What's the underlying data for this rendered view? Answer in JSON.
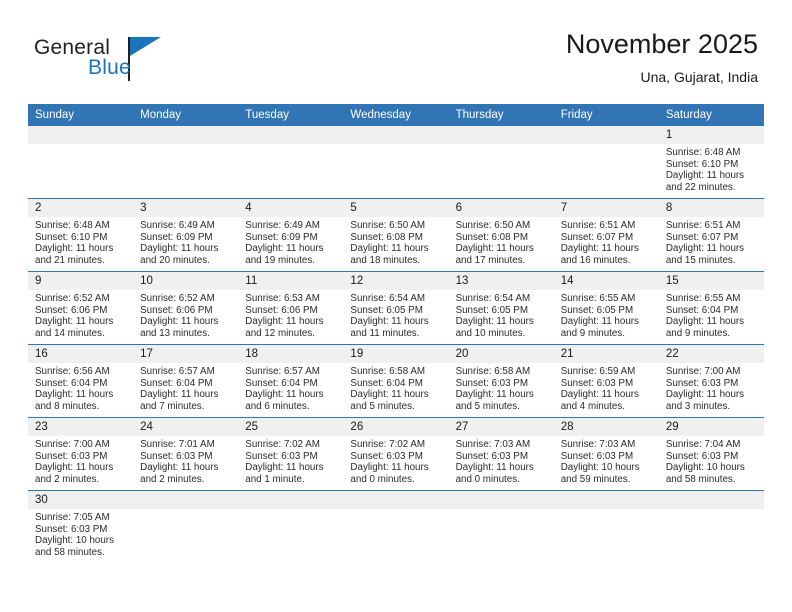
{
  "brand": {
    "name_top": "General",
    "name_bottom": "Blue",
    "accent_color": "#1b75bb",
    "text_color": "#231f20"
  },
  "header": {
    "title": "November 2025",
    "location": "Una, Gujarat, India"
  },
  "theme": {
    "header_blue": "#3175b4",
    "daynum_band": "#f0f0f0",
    "row_rule": "#3175b4"
  },
  "weekday_headers": [
    "Sunday",
    "Monday",
    "Tuesday",
    "Wednesday",
    "Thursday",
    "Friday",
    "Saturday"
  ],
  "weeks": [
    [
      {
        "day": "",
        "empty": true,
        "sunrise": "",
        "sunset": "",
        "daylight1": "",
        "daylight2": ""
      },
      {
        "day": "",
        "empty": true,
        "sunrise": "",
        "sunset": "",
        "daylight1": "",
        "daylight2": ""
      },
      {
        "day": "",
        "empty": true,
        "sunrise": "",
        "sunset": "",
        "daylight1": "",
        "daylight2": ""
      },
      {
        "day": "",
        "empty": true,
        "sunrise": "",
        "sunset": "",
        "daylight1": "",
        "daylight2": ""
      },
      {
        "day": "",
        "empty": true,
        "sunrise": "",
        "sunset": "",
        "daylight1": "",
        "daylight2": ""
      },
      {
        "day": "",
        "empty": true,
        "sunrise": "",
        "sunset": "",
        "daylight1": "",
        "daylight2": ""
      },
      {
        "day": "1",
        "empty": false,
        "sunrise": "Sunrise: 6:48 AM",
        "sunset": "Sunset: 6:10 PM",
        "daylight1": "Daylight: 11 hours",
        "daylight2": "and 22 minutes."
      }
    ],
    [
      {
        "day": "2",
        "empty": false,
        "sunrise": "Sunrise: 6:48 AM",
        "sunset": "Sunset: 6:10 PM",
        "daylight1": "Daylight: 11 hours",
        "daylight2": "and 21 minutes."
      },
      {
        "day": "3",
        "empty": false,
        "sunrise": "Sunrise: 6:49 AM",
        "sunset": "Sunset: 6:09 PM",
        "daylight1": "Daylight: 11 hours",
        "daylight2": "and 20 minutes."
      },
      {
        "day": "4",
        "empty": false,
        "sunrise": "Sunrise: 6:49 AM",
        "sunset": "Sunset: 6:09 PM",
        "daylight1": "Daylight: 11 hours",
        "daylight2": "and 19 minutes."
      },
      {
        "day": "5",
        "empty": false,
        "sunrise": "Sunrise: 6:50 AM",
        "sunset": "Sunset: 6:08 PM",
        "daylight1": "Daylight: 11 hours",
        "daylight2": "and 18 minutes."
      },
      {
        "day": "6",
        "empty": false,
        "sunrise": "Sunrise: 6:50 AM",
        "sunset": "Sunset: 6:08 PM",
        "daylight1": "Daylight: 11 hours",
        "daylight2": "and 17 minutes."
      },
      {
        "day": "7",
        "empty": false,
        "sunrise": "Sunrise: 6:51 AM",
        "sunset": "Sunset: 6:07 PM",
        "daylight1": "Daylight: 11 hours",
        "daylight2": "and 16 minutes."
      },
      {
        "day": "8",
        "empty": false,
        "sunrise": "Sunrise: 6:51 AM",
        "sunset": "Sunset: 6:07 PM",
        "daylight1": "Daylight: 11 hours",
        "daylight2": "and 15 minutes."
      }
    ],
    [
      {
        "day": "9",
        "empty": false,
        "sunrise": "Sunrise: 6:52 AM",
        "sunset": "Sunset: 6:06 PM",
        "daylight1": "Daylight: 11 hours",
        "daylight2": "and 14 minutes."
      },
      {
        "day": "10",
        "empty": false,
        "sunrise": "Sunrise: 6:52 AM",
        "sunset": "Sunset: 6:06 PM",
        "daylight1": "Daylight: 11 hours",
        "daylight2": "and 13 minutes."
      },
      {
        "day": "11",
        "empty": false,
        "sunrise": "Sunrise: 6:53 AM",
        "sunset": "Sunset: 6:06 PM",
        "daylight1": "Daylight: 11 hours",
        "daylight2": "and 12 minutes."
      },
      {
        "day": "12",
        "empty": false,
        "sunrise": "Sunrise: 6:54 AM",
        "sunset": "Sunset: 6:05 PM",
        "daylight1": "Daylight: 11 hours",
        "daylight2": "and 11 minutes."
      },
      {
        "day": "13",
        "empty": false,
        "sunrise": "Sunrise: 6:54 AM",
        "sunset": "Sunset: 6:05 PM",
        "daylight1": "Daylight: 11 hours",
        "daylight2": "and 10 minutes."
      },
      {
        "day": "14",
        "empty": false,
        "sunrise": "Sunrise: 6:55 AM",
        "sunset": "Sunset: 6:05 PM",
        "daylight1": "Daylight: 11 hours",
        "daylight2": "and 9 minutes."
      },
      {
        "day": "15",
        "empty": false,
        "sunrise": "Sunrise: 6:55 AM",
        "sunset": "Sunset: 6:04 PM",
        "daylight1": "Daylight: 11 hours",
        "daylight2": "and 9 minutes."
      }
    ],
    [
      {
        "day": "16",
        "empty": false,
        "sunrise": "Sunrise: 6:56 AM",
        "sunset": "Sunset: 6:04 PM",
        "daylight1": "Daylight: 11 hours",
        "daylight2": "and 8 minutes."
      },
      {
        "day": "17",
        "empty": false,
        "sunrise": "Sunrise: 6:57 AM",
        "sunset": "Sunset: 6:04 PM",
        "daylight1": "Daylight: 11 hours",
        "daylight2": "and 7 minutes."
      },
      {
        "day": "18",
        "empty": false,
        "sunrise": "Sunrise: 6:57 AM",
        "sunset": "Sunset: 6:04 PM",
        "daylight1": "Daylight: 11 hours",
        "daylight2": "and 6 minutes."
      },
      {
        "day": "19",
        "empty": false,
        "sunrise": "Sunrise: 6:58 AM",
        "sunset": "Sunset: 6:04 PM",
        "daylight1": "Daylight: 11 hours",
        "daylight2": "and 5 minutes."
      },
      {
        "day": "20",
        "empty": false,
        "sunrise": "Sunrise: 6:58 AM",
        "sunset": "Sunset: 6:03 PM",
        "daylight1": "Daylight: 11 hours",
        "daylight2": "and 5 minutes."
      },
      {
        "day": "21",
        "empty": false,
        "sunrise": "Sunrise: 6:59 AM",
        "sunset": "Sunset: 6:03 PM",
        "daylight1": "Daylight: 11 hours",
        "daylight2": "and 4 minutes."
      },
      {
        "day": "22",
        "empty": false,
        "sunrise": "Sunrise: 7:00 AM",
        "sunset": "Sunset: 6:03 PM",
        "daylight1": "Daylight: 11 hours",
        "daylight2": "and 3 minutes."
      }
    ],
    [
      {
        "day": "23",
        "empty": false,
        "sunrise": "Sunrise: 7:00 AM",
        "sunset": "Sunset: 6:03 PM",
        "daylight1": "Daylight: 11 hours",
        "daylight2": "and 2 minutes."
      },
      {
        "day": "24",
        "empty": false,
        "sunrise": "Sunrise: 7:01 AM",
        "sunset": "Sunset: 6:03 PM",
        "daylight1": "Daylight: 11 hours",
        "daylight2": "and 2 minutes."
      },
      {
        "day": "25",
        "empty": false,
        "sunrise": "Sunrise: 7:02 AM",
        "sunset": "Sunset: 6:03 PM",
        "daylight1": "Daylight: 11 hours",
        "daylight2": "and 1 minute."
      },
      {
        "day": "26",
        "empty": false,
        "sunrise": "Sunrise: 7:02 AM",
        "sunset": "Sunset: 6:03 PM",
        "daylight1": "Daylight: 11 hours",
        "daylight2": "and 0 minutes."
      },
      {
        "day": "27",
        "empty": false,
        "sunrise": "Sunrise: 7:03 AM",
        "sunset": "Sunset: 6:03 PM",
        "daylight1": "Daylight: 11 hours",
        "daylight2": "and 0 minutes."
      },
      {
        "day": "28",
        "empty": false,
        "sunrise": "Sunrise: 7:03 AM",
        "sunset": "Sunset: 6:03 PM",
        "daylight1": "Daylight: 10 hours",
        "daylight2": "and 59 minutes."
      },
      {
        "day": "29",
        "empty": false,
        "sunrise": "Sunrise: 7:04 AM",
        "sunset": "Sunset: 6:03 PM",
        "daylight1": "Daylight: 10 hours",
        "daylight2": "and 58 minutes."
      }
    ],
    [
      {
        "day": "30",
        "empty": false,
        "sunrise": "Sunrise: 7:05 AM",
        "sunset": "Sunset: 6:03 PM",
        "daylight1": "Daylight: 10 hours",
        "daylight2": "and 58 minutes."
      },
      {
        "day": "",
        "empty": true,
        "sunrise": "",
        "sunset": "",
        "daylight1": "",
        "daylight2": ""
      },
      {
        "day": "",
        "empty": true,
        "sunrise": "",
        "sunset": "",
        "daylight1": "",
        "daylight2": ""
      },
      {
        "day": "",
        "empty": true,
        "sunrise": "",
        "sunset": "",
        "daylight1": "",
        "daylight2": ""
      },
      {
        "day": "",
        "empty": true,
        "sunrise": "",
        "sunset": "",
        "daylight1": "",
        "daylight2": ""
      },
      {
        "day": "",
        "empty": true,
        "sunrise": "",
        "sunset": "",
        "daylight1": "",
        "daylight2": ""
      },
      {
        "day": "",
        "empty": true,
        "sunrise": "",
        "sunset": "",
        "daylight1": "",
        "daylight2": ""
      }
    ]
  ]
}
